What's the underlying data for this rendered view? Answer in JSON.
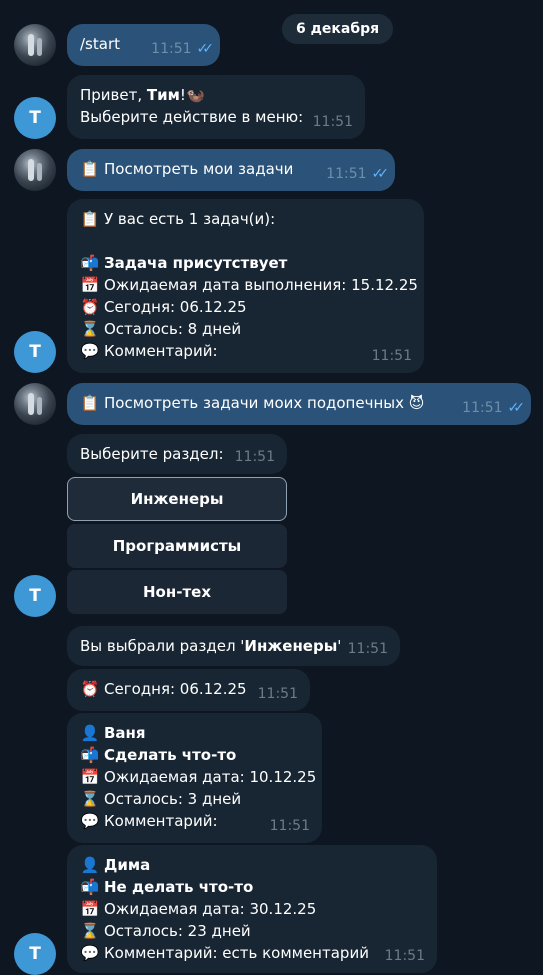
{
  "date_separator": "6 декабря",
  "bot_avatar_letter": "Т",
  "messages": [
    {
      "text": "/start",
      "time": "11:51",
      "ticks": "✓✓"
    },
    {
      "greeting_prefix": "Привет, ",
      "greeting_name": "Тим",
      "greeting_suffix": "!",
      "greeting_emoji": "🦦",
      "line2": "Выберите действие в меню:",
      "time": "11:51"
    },
    {
      "icon": "📋",
      "text": "Посмотреть мои задачи",
      "time": "11:51",
      "ticks": "✓✓"
    },
    {
      "header_icon": "📋",
      "header": "У вас есть 1 задач(и):",
      "task_icon": "📬",
      "task": "Задача присутствует",
      "due_icon": "📅",
      "due": "Ожидаемая дата выполнения: 15.12.25",
      "today_icon": "⏰",
      "today": "Сегодня: 06.12.25",
      "left_icon": "⌛",
      "left": "Осталось: 8 дней",
      "comment_icon": "💬",
      "comment": "Комментарий:",
      "time": "11:51"
    },
    {
      "icon": "📋",
      "text": "Посмотреть задачи моих подопечных",
      "emoji": "😈",
      "time": "11:51",
      "ticks": "✓✓"
    },
    {
      "text": "Выберите раздел:",
      "time": "11:51"
    },
    {
      "prefix": "Вы выбрали раздел '",
      "bold": "Инженеры",
      "suffix": "'",
      "time": "11:51"
    },
    {
      "icon": "⏰",
      "text": "Сегодня: 06.12.25",
      "time": "11:51"
    },
    {
      "person_icon": "👤",
      "person": "Ваня",
      "task_icon": "📬",
      "task": "Сделать что-то",
      "due_icon": "📅",
      "due": "Ожидаемая дата: 10.12.25",
      "left_icon": "⌛",
      "left": "Осталось: 3 дней",
      "comment_icon": "💬",
      "comment": "Комментарий:",
      "time": "11:51"
    },
    {
      "person_icon": "👤",
      "person": "Дима",
      "task_icon": "📬",
      "task": "Не делать что-то",
      "due_icon": "📅",
      "due": "Ожидаемая дата: 30.12.25",
      "left_icon": "⌛",
      "left": "Осталось: 23 дней",
      "comment_icon": "💬",
      "comment": "Комментарий: есть комментарий",
      "time": "11:51"
    }
  ],
  "keyboard": [
    "Инженеры",
    "Программисты",
    "Нон-тех"
  ],
  "colors": {
    "background": "#0e1621",
    "outgoing": "#2b5278",
    "incoming": "#182533",
    "avatar": "#3e98d6",
    "ticks": "#5fb4ff"
  }
}
